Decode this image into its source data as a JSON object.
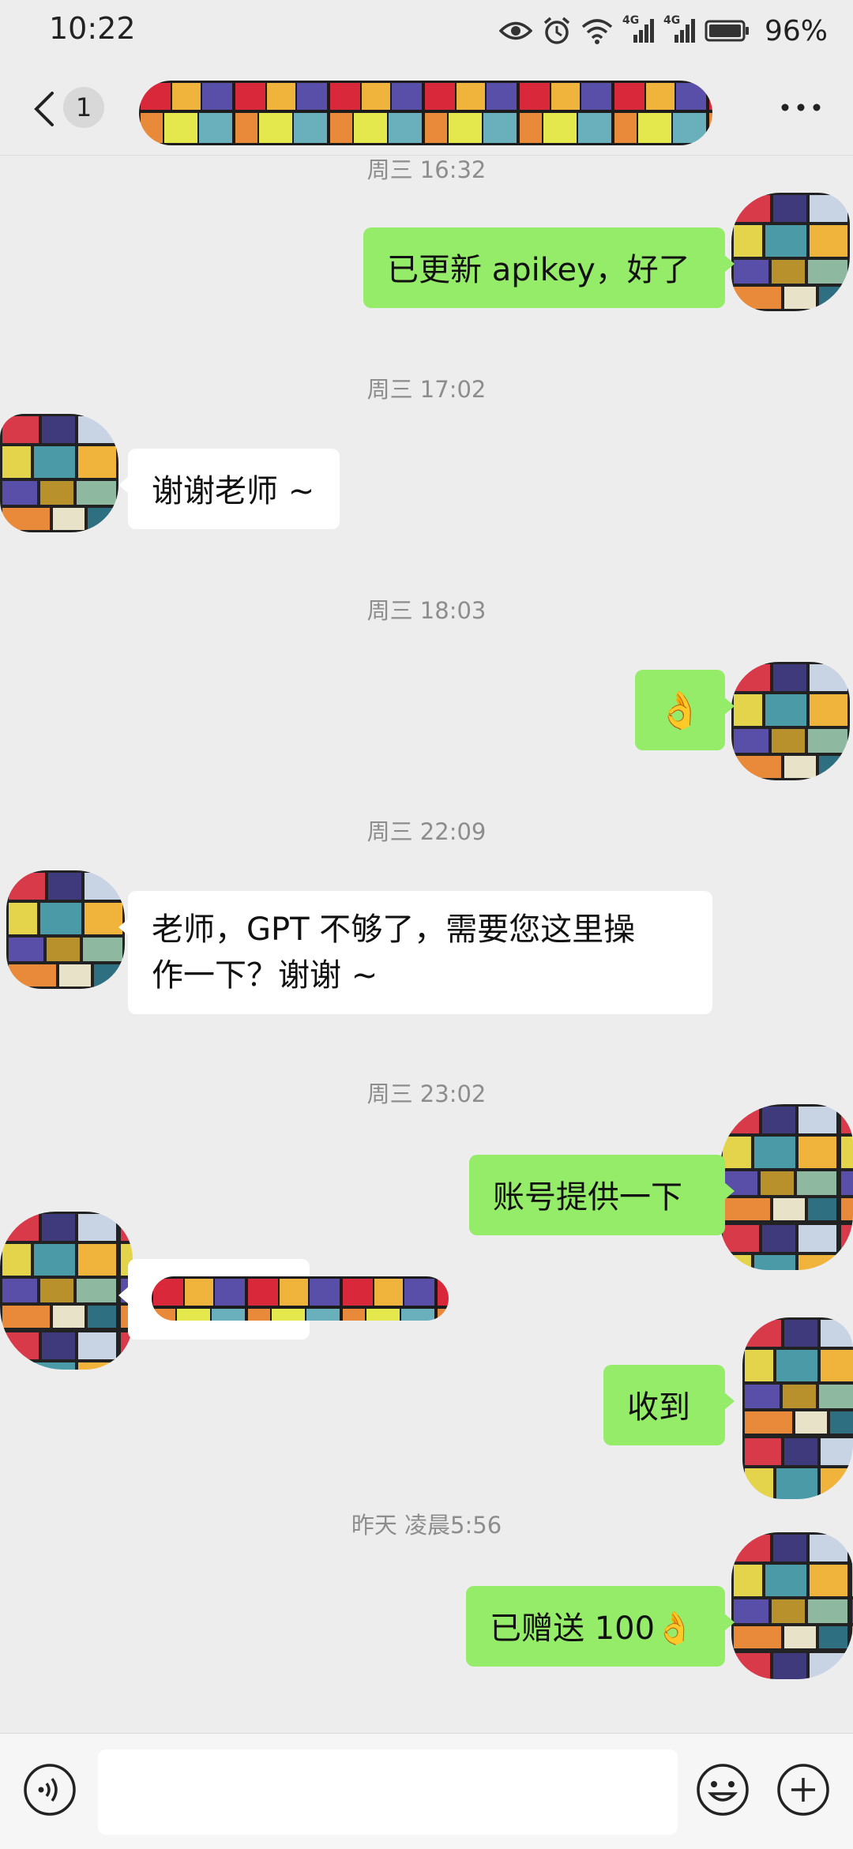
{
  "status_bar": {
    "time": "10:22",
    "network_1": "4G",
    "network_2": "4G",
    "battery": "96%",
    "icons": [
      "eye-icon",
      "alarm-icon",
      "wifi-icon",
      "signal-icon",
      "signal-icon",
      "battery-icon"
    ]
  },
  "header": {
    "unread_count": "1",
    "contact_name_redacted": true
  },
  "messages": [
    {
      "type": "time",
      "text": "周三 16:32"
    },
    {
      "type": "msg",
      "side": "out",
      "text": "已更新 apikey，好了"
    },
    {
      "type": "time",
      "text": "周三 17:02"
    },
    {
      "type": "msg",
      "side": "in",
      "text": "谢谢老师 ~"
    },
    {
      "type": "time",
      "text": "周三 18:03"
    },
    {
      "type": "msg",
      "side": "out",
      "emoji": "👌"
    },
    {
      "type": "time",
      "text": "周三 22:09"
    },
    {
      "type": "msg",
      "side": "in",
      "text_line1": "老师，GPT 不够了，需要您这里操",
      "text_line2": "作一下？谢谢 ~"
    },
    {
      "type": "time",
      "text": "周三 23:02"
    },
    {
      "type": "msg",
      "side": "out",
      "text": "账号提供一下"
    },
    {
      "type": "msg",
      "side": "in",
      "redacted": true
    },
    {
      "type": "msg",
      "side": "out",
      "text": "收到"
    },
    {
      "type": "time",
      "text": "昨天 凌晨5:56"
    },
    {
      "type": "msg",
      "side": "out",
      "text": "已赠送 100",
      "emoji": "👌"
    }
  ],
  "input_bar": {
    "icons": [
      "voice-icon",
      "emoji-icon",
      "plus-icon"
    ],
    "value": ""
  },
  "colors": {
    "background": "#ededed",
    "outgoing_bubble": "#95ec69",
    "incoming_bubble": "#ffffff",
    "timestamp_text": "#8d8d8d"
  }
}
